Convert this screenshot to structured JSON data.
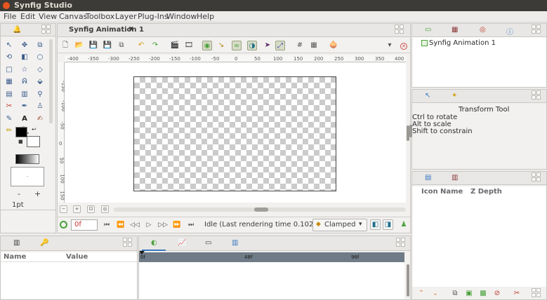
{
  "app": {
    "title": "Synfig Studio"
  },
  "menu": [
    "File",
    "Edit",
    "View",
    "Canvas",
    "Toolbox",
    "Layer",
    "Plug-Ins",
    "Window",
    "Help"
  ],
  "document_tab": {
    "label": "Synfig Animation 1",
    "close_glyph": "✖"
  },
  "ruler_h_ticks": [
    "-400",
    "-350",
    "-300",
    "-250",
    "-200",
    "-150",
    "-100",
    "-50",
    "0",
    "50",
    "100",
    "150",
    "200",
    "250",
    "300",
    "350",
    "400"
  ],
  "ruler_v_ticks": [
    "-150",
    "-100",
    "-50",
    "0",
    "50",
    "100",
    "150"
  ],
  "frame_field": {
    "value": "0f"
  },
  "status": {
    "text": "Idle (Last rendering time 0.10266..."
  },
  "interpolation": {
    "value": "Clamped"
  },
  "brush_size": "1pt",
  "size_minus": "-",
  "size_plus": "+",
  "canvas_browser": {
    "item": "Synfig Animation 1"
  },
  "tool_options": {
    "title": "Transform Tool",
    "lines": [
      "Ctrl to rotate",
      "Alt to scale",
      "Shift to constrain"
    ]
  },
  "layers_panel": {
    "columns": [
      "Icon",
      "Name",
      "Z Depth"
    ]
  },
  "params_panel": {
    "columns": [
      "Name",
      "Value"
    ]
  },
  "timetrack": {
    "labels": [
      "0f",
      "48f",
      "96f"
    ]
  },
  "colors": {
    "accent_green": "#4aa03a",
    "title_bar": "#3c3b37",
    "close_orange": "#e9541f"
  }
}
